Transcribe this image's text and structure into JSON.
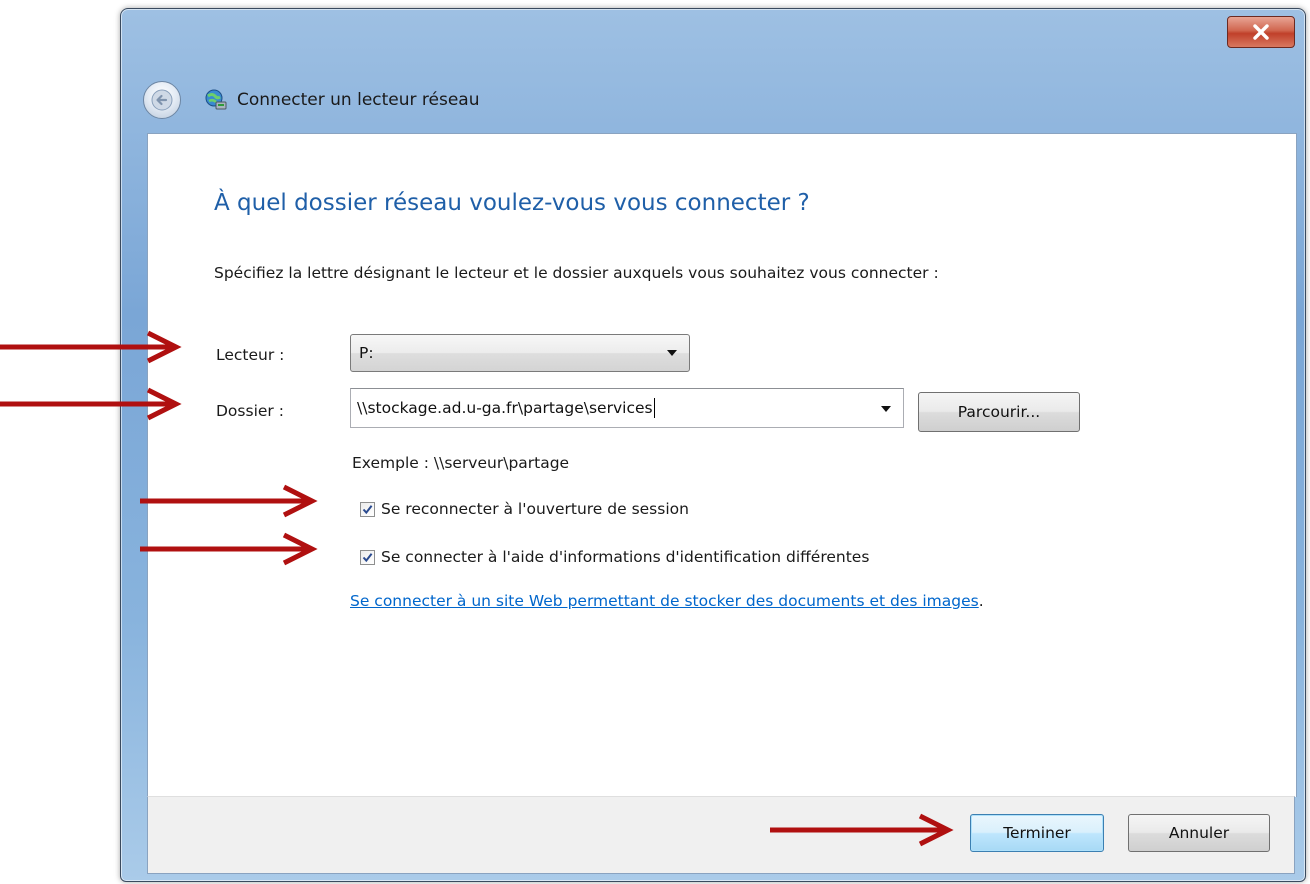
{
  "window": {
    "title": "Connecter un lecteur réseau",
    "close_glyph": "x"
  },
  "content": {
    "heading": "À quel dossier réseau voulez-vous vous connecter ?",
    "instruction": "Spécifiez la lettre désignant le lecteur et le dossier auxquels vous souhaitez vous connecter :",
    "drive_label": "Lecteur :",
    "drive_value": "P:",
    "folder_label": "Dossier :",
    "folder_value": "\\\\stockage.ad.u-ga.fr\\partage\\services",
    "browse_label": "Parcourir...",
    "example_text": "Exemple : \\\\serveur\\partage",
    "reconnect_label": "Se reconnecter à l'ouverture de session",
    "reconnect_checked": true,
    "different_credentials_label": "Se connecter à l'aide d'informations d'identification différentes",
    "different_credentials_checked": true,
    "website_link": "Se connecter à un site Web permettant de stocker des documents et des images",
    "website_link_suffix": "."
  },
  "footer": {
    "finish_label": "Terminer",
    "cancel_label": "Annuler"
  },
  "colors": {
    "heading": "#1f5fa8",
    "link": "#0066cc",
    "annotation_arrow": "#b01010"
  },
  "icons": [
    "close-icon",
    "back-arrow-icon",
    "network-drive-icon",
    "dropdown-arrow-icon",
    "checkmark-icon",
    "annotation-arrow-icon"
  ]
}
